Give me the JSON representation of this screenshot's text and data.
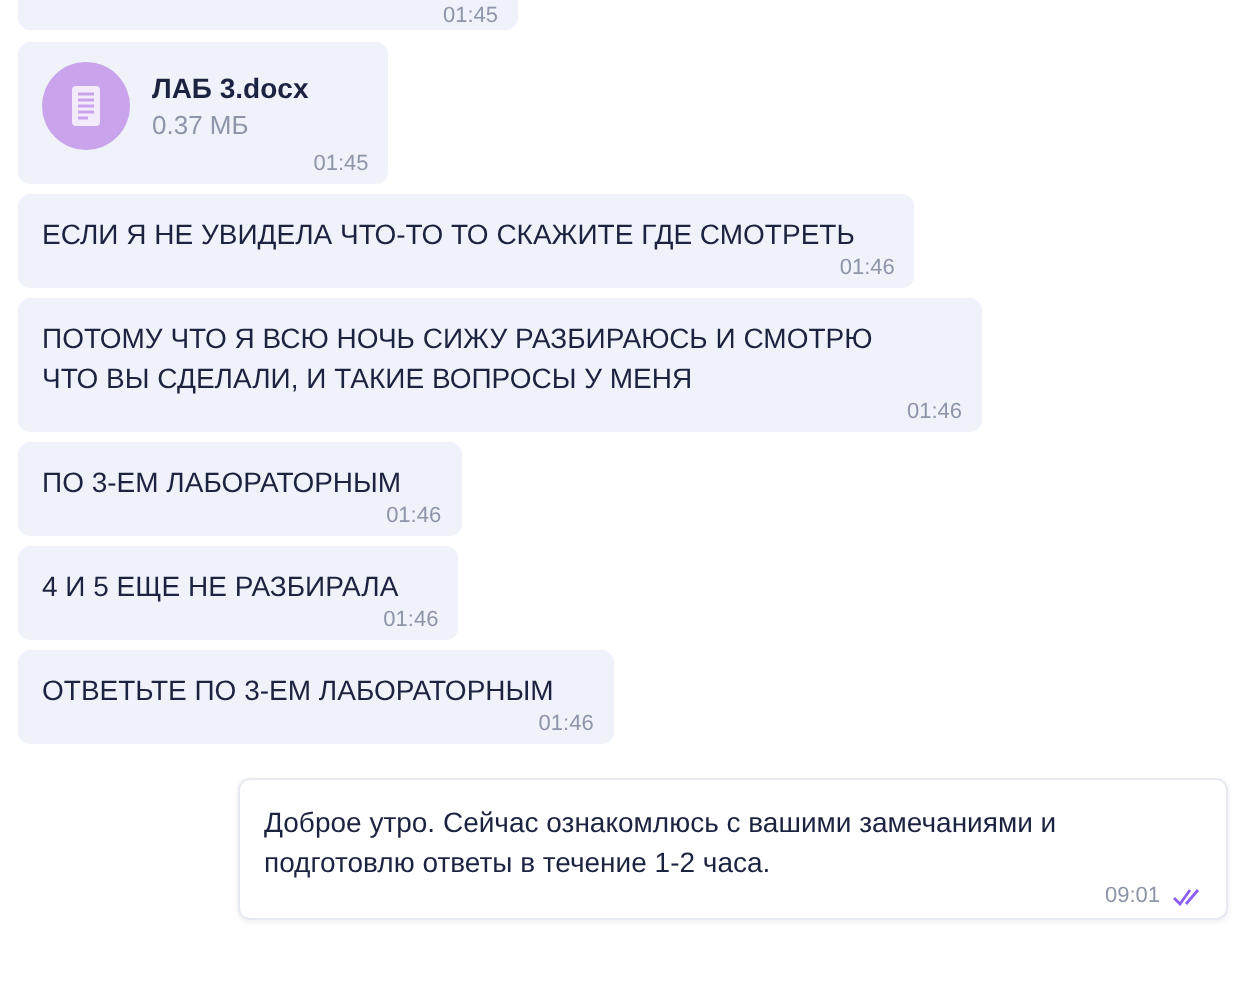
{
  "messages": [
    {
      "kind": "partial",
      "time": "01:45"
    },
    {
      "kind": "file",
      "outgoing": false,
      "file_name": "ЛАБ 3.docx",
      "file_size": "0.37 МБ",
      "time": "01:45"
    },
    {
      "kind": "text",
      "outgoing": false,
      "text": "ЕСЛИ Я НЕ УВИДЕЛА ЧТО-ТО ТО СКАЖИТЕ ГДЕ СМОТРЕТЬ",
      "time": "01:46"
    },
    {
      "kind": "text",
      "outgoing": false,
      "text": "ПОТОМУ ЧТО Я ВСЮ НОЧЬ СИЖУ РАЗБИРАЮСЬ И СМОТРЮ ЧТО ВЫ СДЕЛАЛИ, И ТАКИЕ ВОПРОСЫ У МЕНЯ",
      "time": "01:46"
    },
    {
      "kind": "text",
      "outgoing": false,
      "text": "ПО 3-ЕМ ЛАБОРАТОРНЫМ",
      "time": "01:46"
    },
    {
      "kind": "text",
      "outgoing": false,
      "text": "4 И 5 ЕЩЕ НЕ РАЗБИРАЛА",
      "time": "01:46"
    },
    {
      "kind": "text",
      "outgoing": false,
      "text": "ОТВЕТЬТЕ ПО 3-ЕМ ЛАБОРАТОРНЫМ",
      "time": "01:46"
    },
    {
      "kind": "text",
      "outgoing": true,
      "text": "Доброе утро. Сейчас ознакомлюсь с вашими замечаниями и подготовлю ответы в течение 1-2 часа.",
      "time": "09:01",
      "read": true
    }
  ]
}
